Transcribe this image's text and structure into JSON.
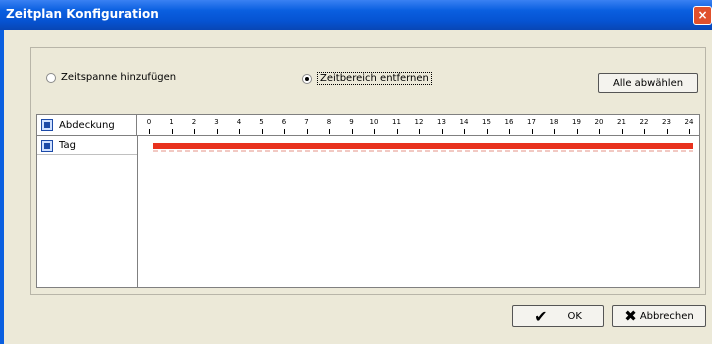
{
  "window": {
    "title": "Zeitplan Konfiguration",
    "close_glyph": "×"
  },
  "options": {
    "add_span_label": "Zeitspanne hinzufügen",
    "remove_range_label": "Zeitbereich entfernen",
    "selected": "remove_range"
  },
  "buttons": {
    "deselect_all": "Alle abwählen",
    "ok": "OK",
    "cancel": "Abbrechen"
  },
  "grid": {
    "header_label": "Abdeckung",
    "hours": [
      "0",
      "1",
      "2",
      "3",
      "4",
      "5",
      "6",
      "7",
      "8",
      "9",
      "10",
      "11",
      "12",
      "13",
      "14",
      "15",
      "16",
      "17",
      "18",
      "19",
      "20",
      "21",
      "22",
      "23",
      "24"
    ],
    "rows": [
      {
        "label": "Tag",
        "range_start": 0,
        "range_end": 24,
        "bar_color": "#e8321e"
      }
    ]
  },
  "icons": {
    "grid_header": "table-icon",
    "row": "schedule-icon",
    "ok": "checkmark-icon",
    "cancel": "x-icon"
  }
}
